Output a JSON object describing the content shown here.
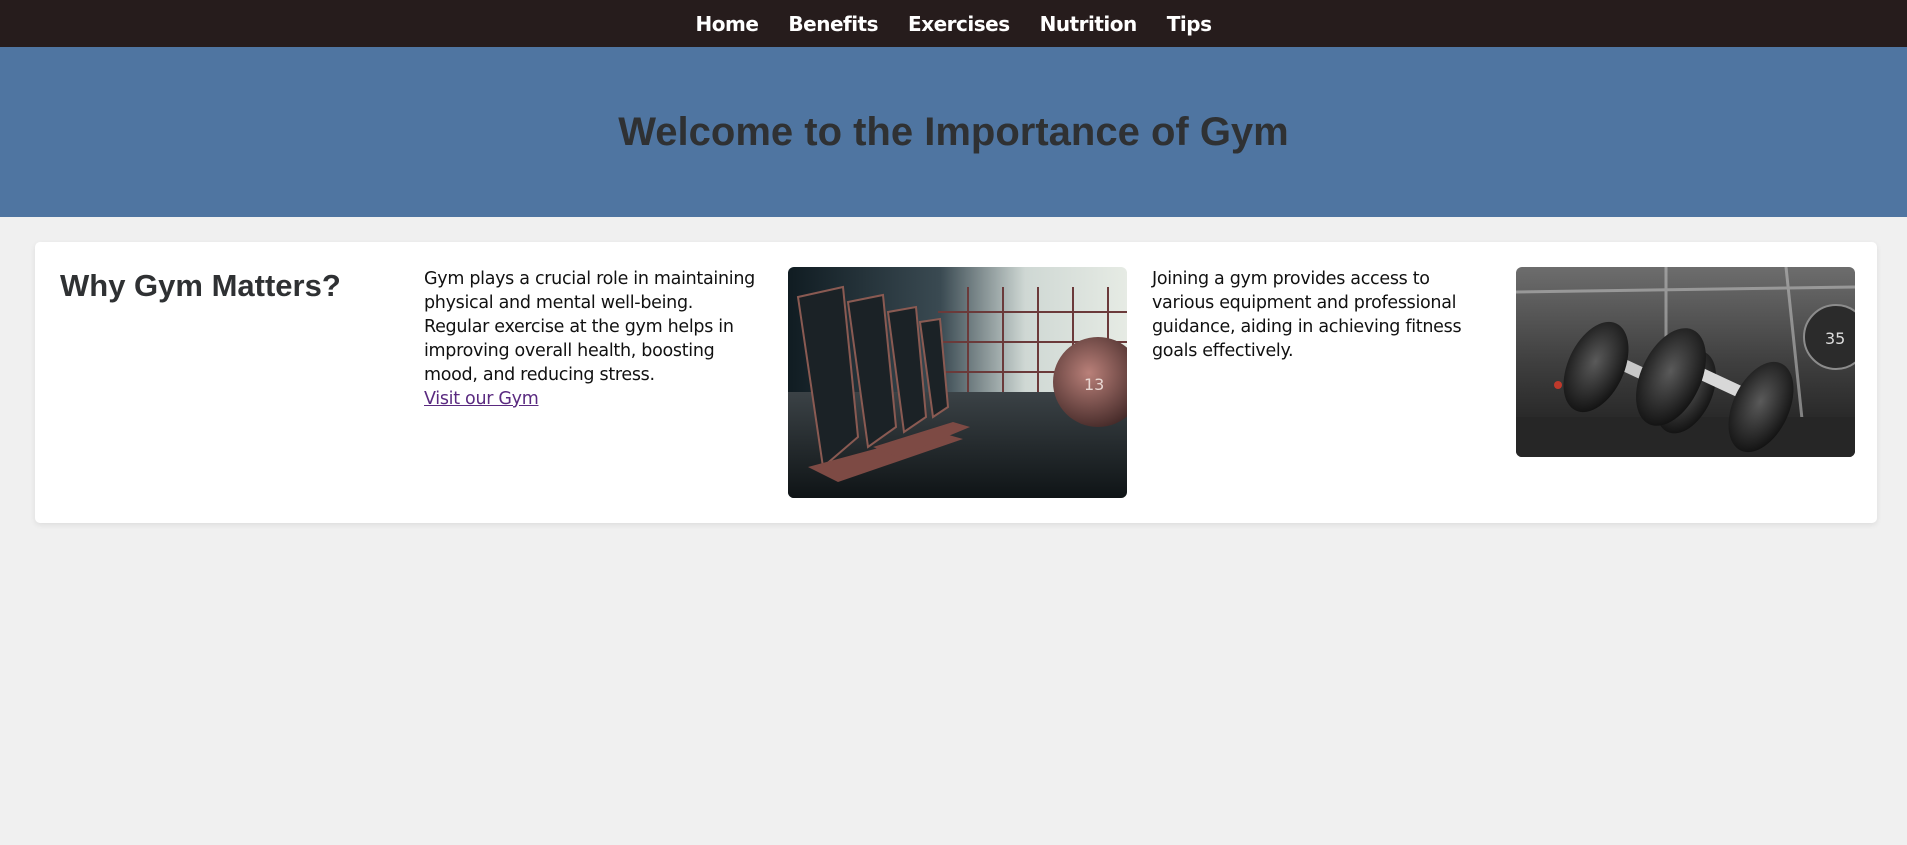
{
  "nav": {
    "items": [
      {
        "label": "Home"
      },
      {
        "label": "Benefits"
      },
      {
        "label": "Exercises"
      },
      {
        "label": "Nutrition"
      },
      {
        "label": "Tips"
      }
    ]
  },
  "hero": {
    "title": "Welcome to the Importance of Gym"
  },
  "section": {
    "heading": "Why Gym Matters?",
    "paragraph1": "Gym plays a crucial role in maintaining physical and mental well-being. Regular exercise at the gym helps in improving overall health, boosting mood, and reducing stress.",
    "link_label": "Visit our Gym",
    "paragraph2": "Joining a gym provides access to various equipment and professional guidance, aiding in achieving fitness goals effectively.",
    "image1_icon": "treadmill-gym-photo",
    "image2_icon": "dumbbells-photo",
    "image1_ball_number": "13",
    "image2_plate_number": "35"
  },
  "colors": {
    "nav_bg": "#261c1c",
    "hero_bg": "#4f75a1",
    "page_bg": "#f0f0f0",
    "link": "#5a2a80"
  }
}
